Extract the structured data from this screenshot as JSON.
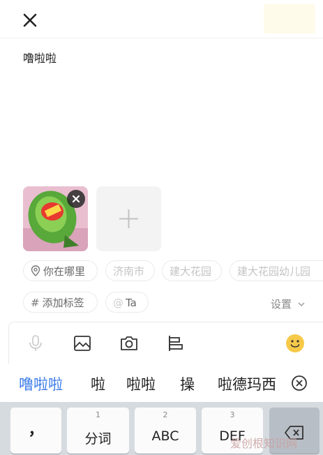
{
  "post": {
    "text": "噜啦啦"
  },
  "location": {
    "current_label": "你在哪里",
    "suggestions": [
      "济南市",
      "建大花园",
      "建大花园幼儿园"
    ]
  },
  "tags": {
    "add_label": "添加标签",
    "mention_label": "Ta"
  },
  "settings_label": "设置",
  "ime": {
    "candidates": [
      "噜啦啦",
      "啦",
      "啦啦",
      "操",
      "啦德玛西"
    ],
    "keys": [
      {
        "num": "",
        "label": "，"
      },
      {
        "num": "1",
        "label": "分词"
      },
      {
        "num": "2",
        "label": "ABC"
      },
      {
        "num": "3",
        "label": "DEF"
      }
    ]
  },
  "watermark": "爱创根知识网",
  "colors": {
    "accent": "#3b7be8",
    "emoji": "#f7c948",
    "keyboard_bg": "#d6dbe0"
  }
}
